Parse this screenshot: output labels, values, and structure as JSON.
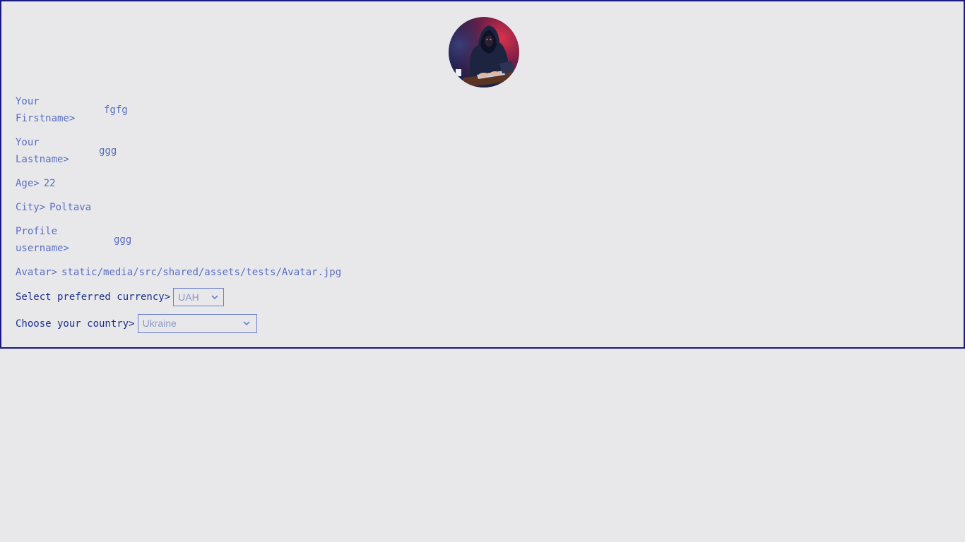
{
  "avatar": {
    "alt": "Avatar"
  },
  "fields": {
    "firstname": {
      "label_line1": "Your",
      "label_line2": "Firstname>",
      "value": "fgfg"
    },
    "lastname": {
      "label_line1": "Your",
      "label_line2": "Lastname>",
      "value": "ggg"
    },
    "age": {
      "label": "Age>",
      "value": "22"
    },
    "city": {
      "label": "City>",
      "value": "Poltava"
    },
    "username": {
      "label_line1": "Profile",
      "label_line2": "username>",
      "value": "ggg"
    },
    "avatar_path": {
      "label": "Avatar>",
      "value": "static/media/src/shared/assets/tests/Avatar.jpg"
    }
  },
  "currency": {
    "label": "Select preferred currency>",
    "selected": "UAH"
  },
  "country": {
    "label": "Choose your country>",
    "selected": "Ukraine"
  },
  "colors": {
    "border": "#1a1a80",
    "text": "#5a6fc0",
    "label_dark": "#1d2f8a",
    "background": "#e8e8ea"
  }
}
